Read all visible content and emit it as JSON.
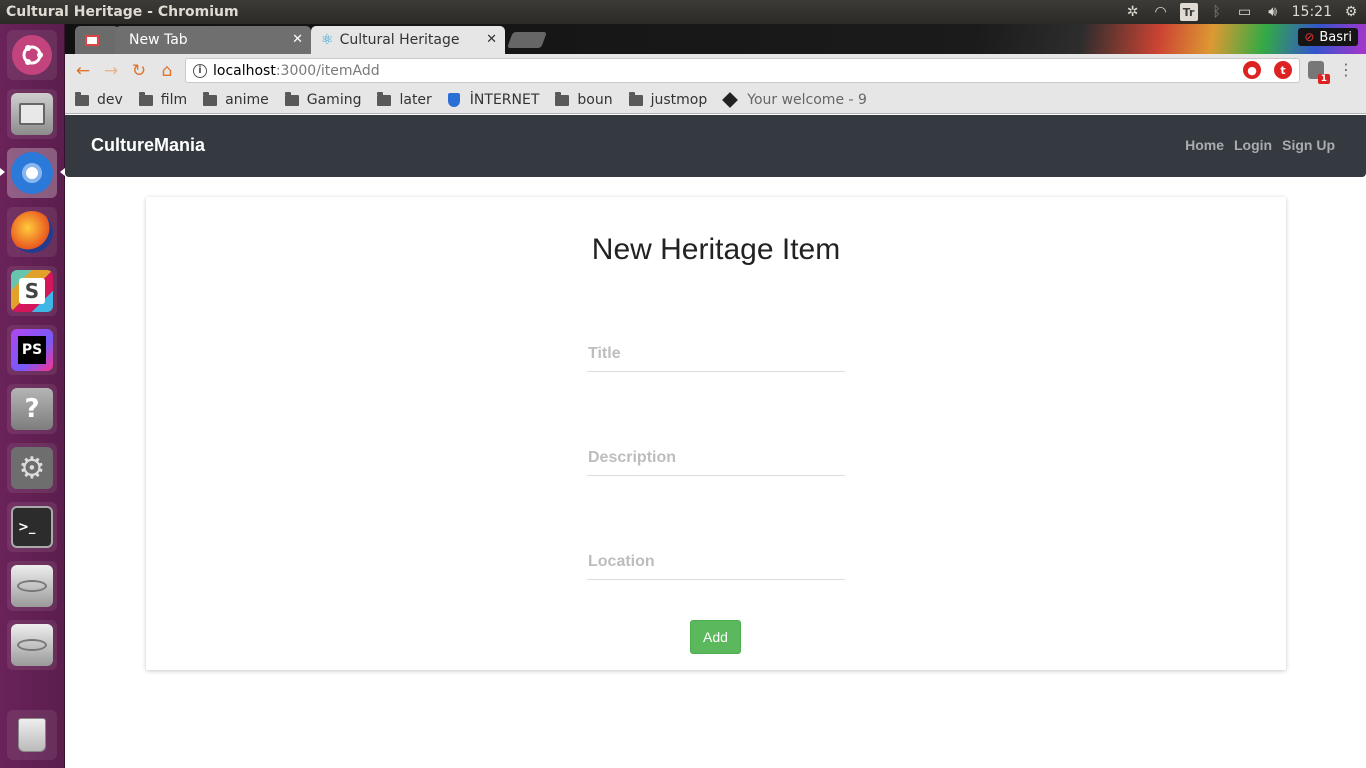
{
  "os": {
    "window_title": "Cultural Heritage - Chromium",
    "tray": {
      "keyboard_indicator": "Tr",
      "clock": "15:21"
    },
    "launcher_items": [
      "ubuntu-dash",
      "files",
      "chromium",
      "firefox",
      "slack",
      "phpstorm",
      "help",
      "system-settings",
      "terminal",
      "drive-1",
      "drive-2",
      "trash"
    ]
  },
  "browser": {
    "tabs": [
      {
        "label": "",
        "icon": "gmail-icon"
      },
      {
        "label": "New Tab"
      },
      {
        "label": "Cultural Heritage",
        "icon": "react-icon"
      }
    ],
    "profile_name": "Basri",
    "url_host": "localhost",
    "url_path": ":3000/itemAdd",
    "extension_badge": "1",
    "extension_t": "t",
    "bookmarks": [
      {
        "label": "dev",
        "icon": "folder-icon"
      },
      {
        "label": "film",
        "icon": "folder-icon"
      },
      {
        "label": "anime",
        "icon": "folder-icon"
      },
      {
        "label": "Gaming",
        "icon": "folder-icon"
      },
      {
        "label": "later",
        "icon": "folder-icon"
      },
      {
        "label": "İNTERNET",
        "icon": "shield-icon"
      },
      {
        "label": "boun",
        "icon": "folder-icon"
      },
      {
        "label": "justmop",
        "icon": "folder-icon"
      },
      {
        "label": "Your welcome - 9",
        "icon": "diamond-icon"
      }
    ]
  },
  "app": {
    "brand": "CultureMania",
    "nav": {
      "home": "Home",
      "login": "Login",
      "signup": "Sign Up"
    },
    "form": {
      "heading": "New Heritage Item",
      "title_placeholder": "Title",
      "description_placeholder": "Description",
      "location_placeholder": "Location",
      "submit_label": "Add"
    }
  },
  "colors": {
    "navbar_bg": "#343a40",
    "button_green": "#5cb85c",
    "launcher_bg": "#5b1e4d"
  }
}
